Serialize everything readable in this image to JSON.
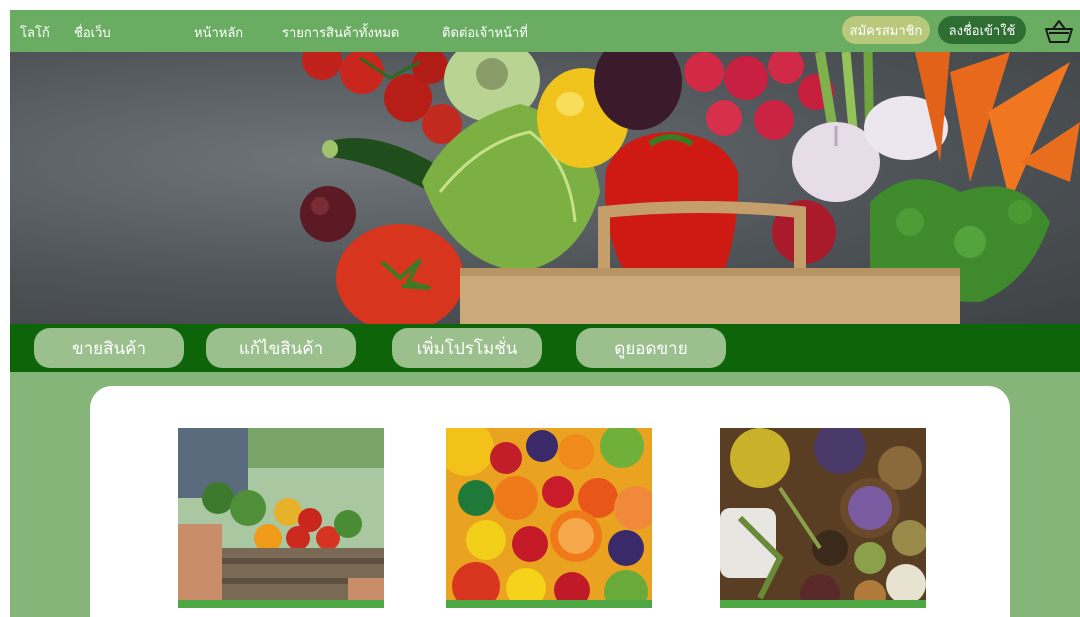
{
  "nav": {
    "logo": "โลโก้",
    "site_name": "ชื่อเว็บ",
    "home": "หน้าหลัก",
    "all_products": "รายการสินค้าทั้งหมด",
    "contact": "ติดต่อเจ้าหน้าที่",
    "signup": "สมัครสมาชิก",
    "login": "ลงชื่อเข้าใช้",
    "cart_icon": "basket-icon"
  },
  "actions": [
    {
      "label": "ขายสินค้า"
    },
    {
      "label": "แก้ไขสินค้า"
    },
    {
      "label": "เพิ่มโปรโมชั่น"
    },
    {
      "label": "ดูยอดขาย"
    }
  ],
  "hero": {
    "image": "vegetables-in-paper-bag"
  },
  "categories": [
    {
      "image": "vegetable-crate"
    },
    {
      "image": "assorted-fruits"
    },
    {
      "image": "dried-herbs"
    }
  ],
  "colors": {
    "nav_bg": "#6aad62",
    "action_bar": "#0e6409",
    "page_bg": "#86b57a",
    "signup_pill": "#b9c97c",
    "login_pill": "#2f6e33"
  }
}
